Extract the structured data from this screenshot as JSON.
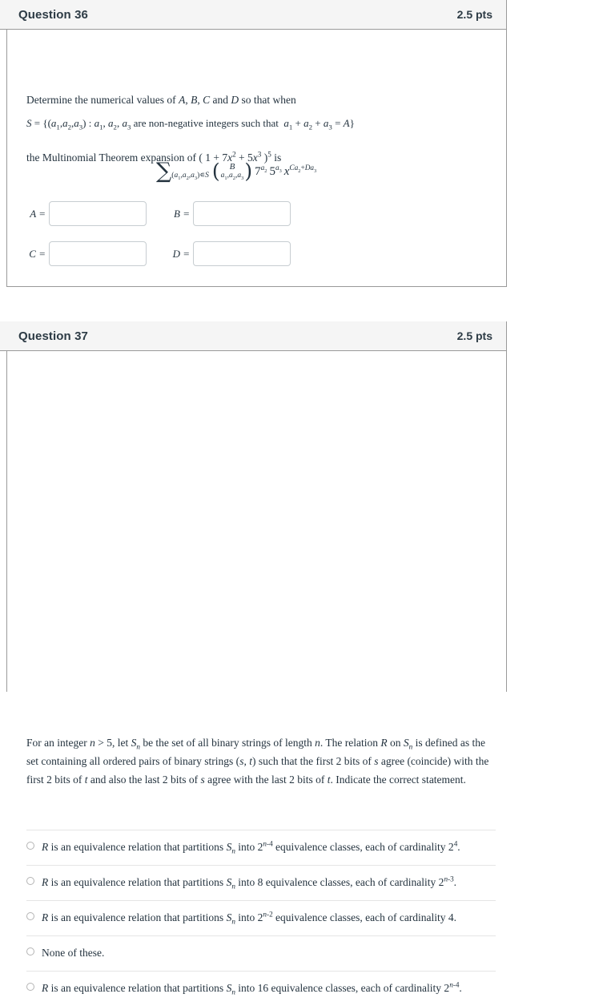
{
  "page": {
    "background": "#ffffff",
    "card_border_color": "#9a9a9a",
    "header_background": "#f5f5f5",
    "text_color": "#24333f",
    "heading_color": "#2d3b45",
    "divider_color": "#e5e5e5",
    "input_border_color": "#c7cdd1"
  },
  "questions": [
    {
      "title": "Question 36",
      "points": "2.5 pts",
      "prompt_line1": "Determine the numerical values of A, B, C and D so that when",
      "prompt_line2": "S = {(a₁, a₂, a₃) : a₁, a₂, a₃ are non-negative integers such that  a₁ + a₂ + a₃ = A}",
      "prompt_line3": "the Multinomial Theorem expansion of ( 1 + 7x² + 5x³ )⁵ is",
      "formula": "Σ_{(a₁,a₂,a₃)∈S} ( B ; a₁,a₂,a₃ ) 7^{a₂} 5^{a₃} x^{Ca₂+Da₃}",
      "formula_parts": {
        "sigma": "∑",
        "sigma_subscript": "(a₁,a₂,a₃)∈S",
        "binom_top": "B",
        "binom_bottom": "a₁,a₂,a₃",
        "term1_base": "7",
        "term1_exp": "a₂",
        "term2_base": "5",
        "term2_exp": "a₃",
        "term3_base": "x",
        "term3_exp": "Ca₂+Da₃"
      },
      "answer_fields": [
        {
          "label": "A =",
          "value": "",
          "placeholder": ""
        },
        {
          "label": "B =",
          "value": "",
          "placeholder": ""
        },
        {
          "label": "C =",
          "value": "",
          "placeholder": ""
        },
        {
          "label": "D =",
          "value": "",
          "placeholder": ""
        }
      ]
    },
    {
      "title": "Question 37",
      "points": "2.5 pts",
      "prompt": "For an integer n > 5, let Sₙ be the set of all binary strings of length n. The relation R on Sₙ is defined as the set containing all ordered pairs of binary strings (s, t) such that the first 2 bits of s agree (coincide) with the first 2 bits of t and also the last 2 bits of s agree with the last 2 bits of t. Indicate the correct statement.",
      "options": [
        {
          "text": "R is an equivalence relation that partitions Sₙ into 2ⁿ⁻⁴ equivalence classes, each of cardinality 2⁴.",
          "selected": false
        },
        {
          "text": "R is an equivalence relation that partitions Sₙ into 8 equivalence classes, each of cardinality 2ⁿ⁻³.",
          "selected": false
        },
        {
          "text": "R is an equivalence relation that partitions Sₙ into 2ⁿ⁻² equivalence classes, each of cardinality 4.",
          "selected": false
        },
        {
          "text": "None of these.",
          "selected": false
        },
        {
          "text": "R is an equivalence relation that partitions Sₙ into 16 equivalence classes, each of cardinality 2ⁿ⁻⁴.",
          "selected": false
        }
      ]
    }
  ]
}
